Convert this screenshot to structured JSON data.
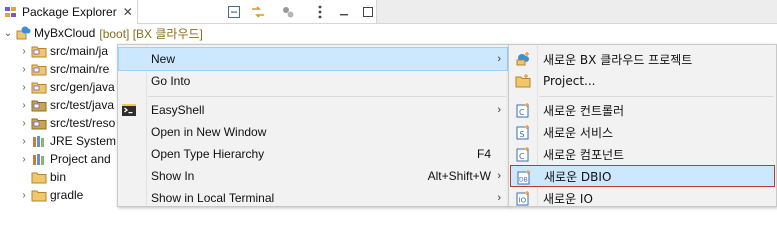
{
  "view": {
    "title": "Package Explorer",
    "close_glyph": "✕",
    "toolbar_icons": [
      "collapse-all-icon",
      "link-with-editor-icon",
      "focus-icon",
      "view-menu-icon",
      "minimize-icon",
      "maximize-icon"
    ]
  },
  "tree": {
    "project": {
      "label": "MyBxCloud",
      "decoration": "[boot] [BX 클라우드]",
      "expanded": true
    },
    "items": [
      {
        "label": "src/main/ja",
        "icon": "source-folder-icon",
        "twisty": "›"
      },
      {
        "label": "src/main/re",
        "icon": "source-folder-icon",
        "twisty": "›"
      },
      {
        "label": "src/gen/java",
        "icon": "source-folder-icon",
        "twisty": "›"
      },
      {
        "label": "src/test/java",
        "icon": "source-folder-icon",
        "twisty": "›"
      },
      {
        "label": "src/test/reso",
        "icon": "source-folder-icon",
        "twisty": "›"
      },
      {
        "label": "JRE System",
        "icon": "library-icon",
        "twisty": "›"
      },
      {
        "label": "Project and",
        "icon": "library-icon",
        "twisty": "›"
      },
      {
        "label": "bin",
        "icon": "folder-icon",
        "twisty": ""
      },
      {
        "label": "gradle",
        "icon": "folder-icon",
        "twisty": "›"
      }
    ]
  },
  "context_menu": {
    "items": [
      {
        "label": "New",
        "submenu": true,
        "selected": true,
        "icon": ""
      },
      {
        "label": "Go Into",
        "submenu": false,
        "icon": ""
      },
      {
        "label": "EasyShell",
        "submenu": true,
        "icon": "terminal-icon"
      },
      {
        "label": "Open in New Window",
        "submenu": false,
        "icon": ""
      },
      {
        "label": "Open Type Hierarchy",
        "shortcut": "F4",
        "icon": ""
      },
      {
        "label": "Show In",
        "shortcut": "Alt+Shift+W",
        "submenu": true,
        "icon": ""
      },
      {
        "label": "Show in Local Terminal",
        "submenu": true,
        "icon": ""
      }
    ],
    "arrow_glyph": "›"
  },
  "submenu": {
    "items": [
      {
        "label": "새로운 BX 클라우드 프로젝트",
        "icon": "cloud-project-icon"
      },
      {
        "label": "Project...",
        "icon": "project-icon"
      },
      {
        "label": "새로운 컨트롤러",
        "icon": "controller-icon"
      },
      {
        "label": "새로운 서비스",
        "icon": "service-icon"
      },
      {
        "label": "새로운 컴포넌트",
        "icon": "component-icon"
      },
      {
        "label": "새로운 DBIO",
        "icon": "dbio-icon",
        "selected": true
      },
      {
        "label": "새로운 IO",
        "icon": "io-icon"
      }
    ]
  },
  "colors": {
    "selection": "#cce8ff",
    "selection_border": "#99d1ff",
    "highlight_border": "#c0392b",
    "menu_bg": "#f2f2f2",
    "decoration": "#8a6d1f"
  }
}
